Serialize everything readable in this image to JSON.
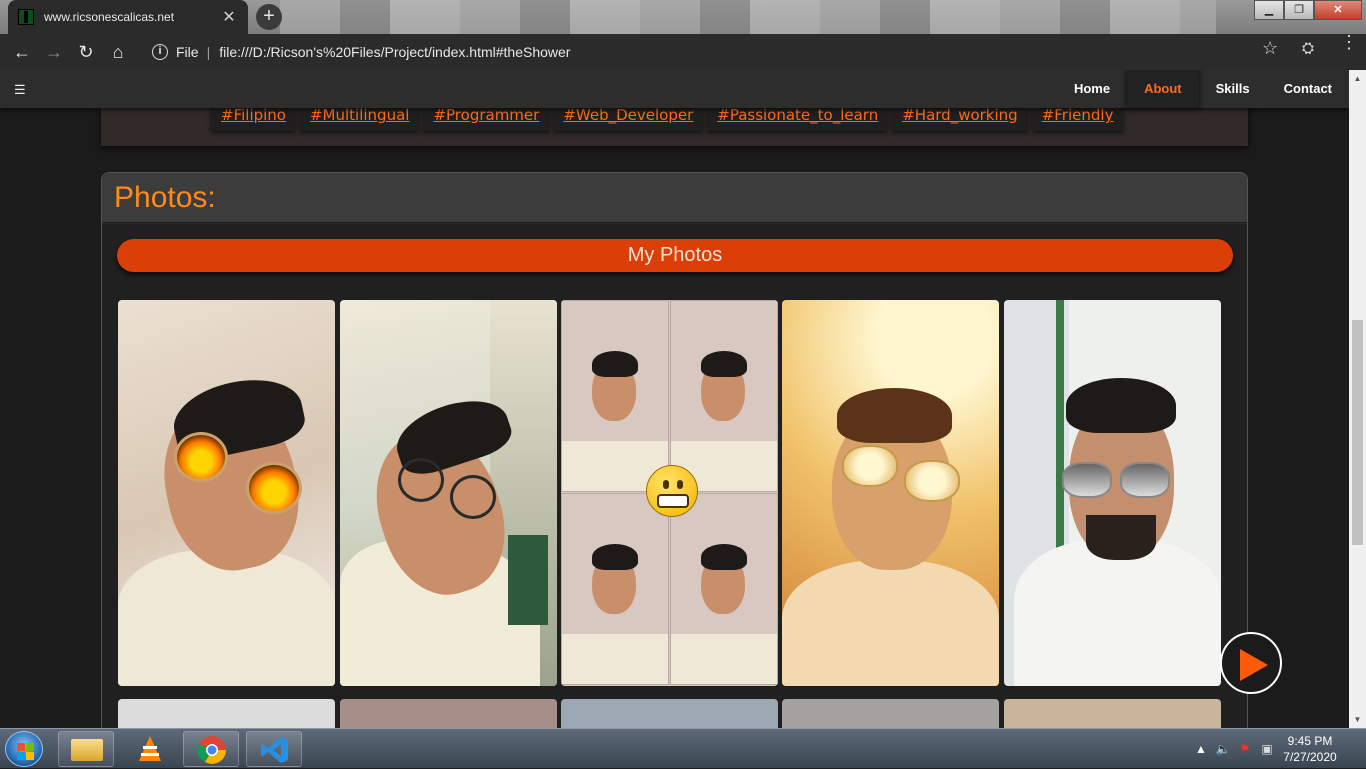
{
  "browser": {
    "tab_title": "www.ricsonescalicas.net",
    "tab_close": "✕",
    "new_tab": "+",
    "window_controls": {
      "minimize": "▁",
      "maximize": "❐",
      "close": "✕"
    },
    "nav_icons": {
      "back": "←",
      "forward": "→",
      "reload": "↻",
      "home": "⌂"
    },
    "address": {
      "info_icon": "i",
      "scheme_label": "File",
      "separator": "|",
      "url": "file:///D:/Ricson's%20Files/Project/index.html#theShower"
    },
    "star_icon": "☆",
    "incognito_icon": "⛭",
    "menu_icon": "⋮"
  },
  "site_nav": {
    "menu_icon": "☰",
    "links": [
      {
        "label": "Home",
        "active": false
      },
      {
        "label": "About",
        "active": true
      },
      {
        "label": "Skills",
        "active": false
      },
      {
        "label": "Contact",
        "active": false
      }
    ],
    "accent_color": "#ff6a1a"
  },
  "hashtags": [
    "#Filipino",
    "#Multilingual",
    "#Programmer",
    "#Web_Developer",
    "#Passionate_to_learn",
    "#Hard_working",
    "#Friendly"
  ],
  "photos": {
    "heading": "Photos:",
    "album_button": "My Photos",
    "button_color": "#d93f06",
    "gallery": [
      {
        "name": "selfie-fire-sunglasses"
      },
      {
        "name": "selfie-round-glasses-classroom"
      },
      {
        "name": "selfie-grid-with-emoji"
      },
      {
        "name": "selfie-gold-aviators"
      },
      {
        "name": "selfie-aviators-beard-filter"
      }
    ],
    "play_icon": "play-icon"
  },
  "taskbar": {
    "tray_arrow": "▲",
    "time": "9:45 PM",
    "date": "7/27/2020"
  }
}
